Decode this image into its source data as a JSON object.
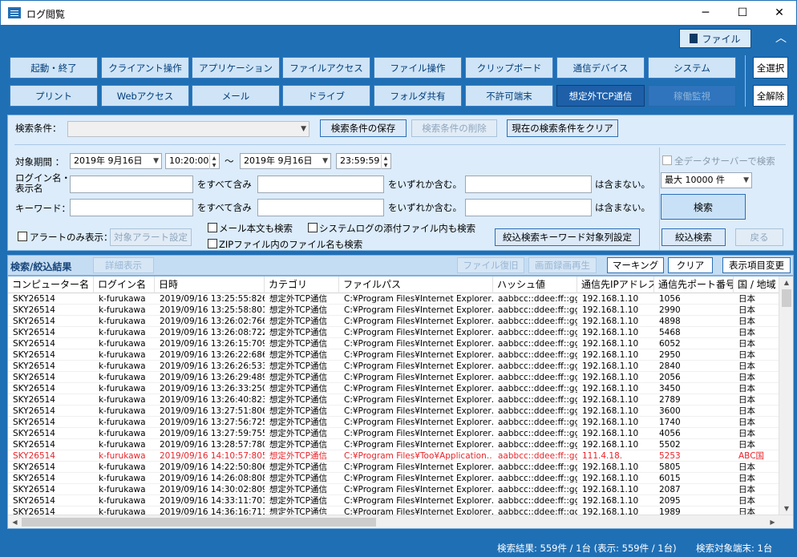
{
  "window": {
    "title": "ログ閲覧",
    "minimize": "─",
    "maximize": "☐",
    "close": "✕"
  },
  "toolbar": {
    "file_label": "ファイル",
    "collapse_label": "︿"
  },
  "categories_row1": [
    {
      "label": "起動・終了"
    },
    {
      "label": "クライアント操作"
    },
    {
      "label": "アプリケーション"
    },
    {
      "label": "ファイルアクセス"
    },
    {
      "label": "ファイル操作"
    },
    {
      "label": "クリップボード"
    },
    {
      "label": "通信デバイス"
    },
    {
      "label": "システム"
    }
  ],
  "categories_row2": [
    {
      "label": "プリント"
    },
    {
      "label": "Webアクセス"
    },
    {
      "label": "メール"
    },
    {
      "label": "ドライブ"
    },
    {
      "label": "フォルダ共有"
    },
    {
      "label": "不許可端末"
    },
    {
      "label": "想定外TCP通信"
    },
    {
      "label": "稼働監視"
    }
  ],
  "side_buttons": {
    "select_all": "全選択",
    "deselect_all": "全解除"
  },
  "search": {
    "condition_label": "検索条件：",
    "condition_value": "",
    "save_condition": "検索条件の保存",
    "delete_condition": "検索条件の削除",
    "clear_condition": "現在の検索条件をクリア",
    "period_label": "対象期間 ：",
    "date_from": "2019年 9月16日",
    "time_from": "10:20:00",
    "tilde": "～",
    "date_to": "2019年 9月16日",
    "time_to": "23:59:59",
    "login_label_1": "ログイン名・",
    "login_label_2": "表示名",
    "keyword_label": "キーワード：",
    "all_contains": "をすべて含み",
    "any_contains": "をいずれか含む。",
    "not_contains": "は含まない。",
    "alert_only_label": "アラートのみ表示：",
    "alert_settings": "対象アラート設定",
    "mail_body": "メール本文も検索",
    "syslog_attach": "システムログの添付ファイル内も検索",
    "zip_names": "ZIPファイル内のファイル名も検索",
    "keyword_cols": "絞込検索キーワード対象列設定",
    "all_servers": "全データサーバーで検索",
    "max_count": "最大 10000 件",
    "search_button": "検索",
    "refine_button": "絞込検索",
    "back_button": "戻る"
  },
  "results": {
    "title": "検索/絞込結果",
    "detail_button": "詳細表示",
    "file_restore": "ファイル復旧",
    "screen_play": "画面録画再生",
    "marking": "マーキング",
    "clear": "クリア",
    "columns_change": "表示項目変更"
  },
  "table": {
    "headers": [
      "コンピューター名",
      "ログイン名",
      "日時",
      "カテゴリ",
      "ファイルパス",
      "ハッシュ値",
      "通信先IPアドレス",
      "通信先ポート番号",
      "国 / 地域"
    ],
    "rows": [
      [
        "SKY26514",
        "k-furukawa",
        "2019/09/16 13:25:55:826",
        "想定外TCP通信",
        "C:¥Program Files¥Internet Explorer…",
        "aabbcc::ddee:ff::gg",
        "192.168.1.10",
        "1056",
        "日本"
      ],
      [
        "SKY26514",
        "k-furukawa",
        "2019/09/16 13:25:58:801",
        "想定外TCP通信",
        "C:¥Program Files¥Internet Explorer…",
        "aabbcc::ddee:ff::gg",
        "192.168.1.10",
        "2990",
        "日本"
      ],
      [
        "SKY26514",
        "k-furukawa",
        "2019/09/16 13:26:02:766",
        "想定外TCP通信",
        "C:¥Program Files¥Internet Explorer…",
        "aabbcc::ddee:ff::gg",
        "192.168.1.10",
        "4898",
        "日本"
      ],
      [
        "SKY26514",
        "k-furukawa",
        "2019/09/16 13:26:08:722",
        "想定外TCP通信",
        "C:¥Program Files¥Internet Explorer…",
        "aabbcc::ddee:ff::gg",
        "192.168.1.10",
        "5468",
        "日本"
      ],
      [
        "SKY26514",
        "k-furukawa",
        "2019/09/16 13:26:15:709",
        "想定外TCP通信",
        "C:¥Program Files¥Internet Explorer…",
        "aabbcc::ddee:ff::gg",
        "192.168.1.10",
        "6052",
        "日本"
      ],
      [
        "SKY26514",
        "k-furukawa",
        "2019/09/16 13:26:22:686",
        "想定外TCP通信",
        "C:¥Program Files¥Internet Explorer…",
        "aabbcc::ddee:ff::gg",
        "192.168.1.10",
        "2950",
        "日本"
      ],
      [
        "SKY26514",
        "k-furukawa",
        "2019/09/16 13:26:26:533",
        "想定外TCP通信",
        "C:¥Program Files¥Internet Explorer…",
        "aabbcc::ddee:ff::gg",
        "192.168.1.10",
        "2840",
        "日本"
      ],
      [
        "SKY26514",
        "k-furukawa",
        "2019/09/16 13:26:29:489",
        "想定外TCP通信",
        "C:¥Program Files¥Internet Explorer…",
        "aabbcc::ddee:ff::gg",
        "192.168.1.10",
        "2056",
        "日本"
      ],
      [
        "SKY26514",
        "k-furukawa",
        "2019/09/16 13:26:33:250",
        "想定外TCP通信",
        "C:¥Program Files¥Internet Explorer…",
        "aabbcc::ddee:ff::gg",
        "192.168.1.10",
        "3450",
        "日本"
      ],
      [
        "SKY26514",
        "k-furukawa",
        "2019/09/16 13:26:40:823",
        "想定外TCP通信",
        "C:¥Program Files¥Internet Explorer…",
        "aabbcc::ddee:ff::gg",
        "192.168.1.10",
        "2789",
        "日本"
      ],
      [
        "SKY26514",
        "k-furukawa",
        "2019/09/16 13:27:51:806",
        "想定外TCP通信",
        "C:¥Program Files¥Internet Explorer…",
        "aabbcc::ddee:ff::gg",
        "192.168.1.10",
        "3600",
        "日本"
      ],
      [
        "SKY26514",
        "k-furukawa",
        "2019/09/16 13:27:56:725",
        "想定外TCP通信",
        "C:¥Program Files¥Internet Explorer…",
        "aabbcc::ddee:ff::gg",
        "192.168.1.10",
        "1740",
        "日本"
      ],
      [
        "SKY26514",
        "k-furukawa",
        "2019/09/16 13:27:59:755",
        "想定外TCP通信",
        "C:¥Program Files¥Internet Explorer…",
        "aabbcc::ddee:ff::gg",
        "192.168.1.10",
        "4056",
        "日本"
      ],
      [
        "SKY26514",
        "k-furukawa",
        "2019/09/16 13:28:57:780",
        "想定外TCP通信",
        "C:¥Program Files¥Internet Explorer…",
        "aabbcc::ddee:ff::gg",
        "192.168.1.10",
        "5502",
        "日本"
      ],
      [
        "SKY26514",
        "k-furukawa",
        "2019/09/16 14:10:57:805",
        "想定外TCP通信",
        "C:¥Program Files¥Too¥Application…",
        "aabbcc::ddee:ff::gg",
        "111.4.18.",
        "5253",
        "ABC国"
      ],
      [
        "SKY26514",
        "k-furukawa",
        "2019/09/16 14:22:50:806",
        "想定外TCP通信",
        "C:¥Program Files¥Internet Explorer…",
        "aabbcc::ddee:ff::gg",
        "192.168.1.10",
        "5805",
        "日本"
      ],
      [
        "SKY26514",
        "k-furukawa",
        "2019/09/16 14:26:08:808",
        "想定外TCP通信",
        "C:¥Program Files¥Internet Explorer…",
        "aabbcc::ddee:ff::gg",
        "192.168.1.10",
        "6015",
        "日本"
      ],
      [
        "SKY26514",
        "k-furukawa",
        "2019/09/16 14:30:02:809",
        "想定外TCP通信",
        "C:¥Program Files¥Internet Explorer…",
        "aabbcc::ddee:ff::gg",
        "192.168.1.10",
        "2087",
        "日本"
      ],
      [
        "SKY26514",
        "k-furukawa",
        "2019/09/16 14:33:11:701",
        "想定外TCP通信",
        "C:¥Program Files¥Internet Explorer…",
        "aabbcc::ddee:ff::gg",
        "192.168.1.10",
        "2095",
        "日本"
      ],
      [
        "SKY26514",
        "k-furukawa",
        "2019/09/16 14:36:16:711",
        "想定外TCP通信",
        "C:¥Program Files¥Internet Explorer…",
        "aabbcc::ddee:ff::gg",
        "192.168.1.10",
        "1989",
        "日本"
      ]
    ],
    "alert_row_index": 14
  },
  "status": {
    "results_text": "検索結果: 559件 / 1台 (表示: 559件 / 1台)",
    "target_text": "検索対象端末: 1台"
  }
}
